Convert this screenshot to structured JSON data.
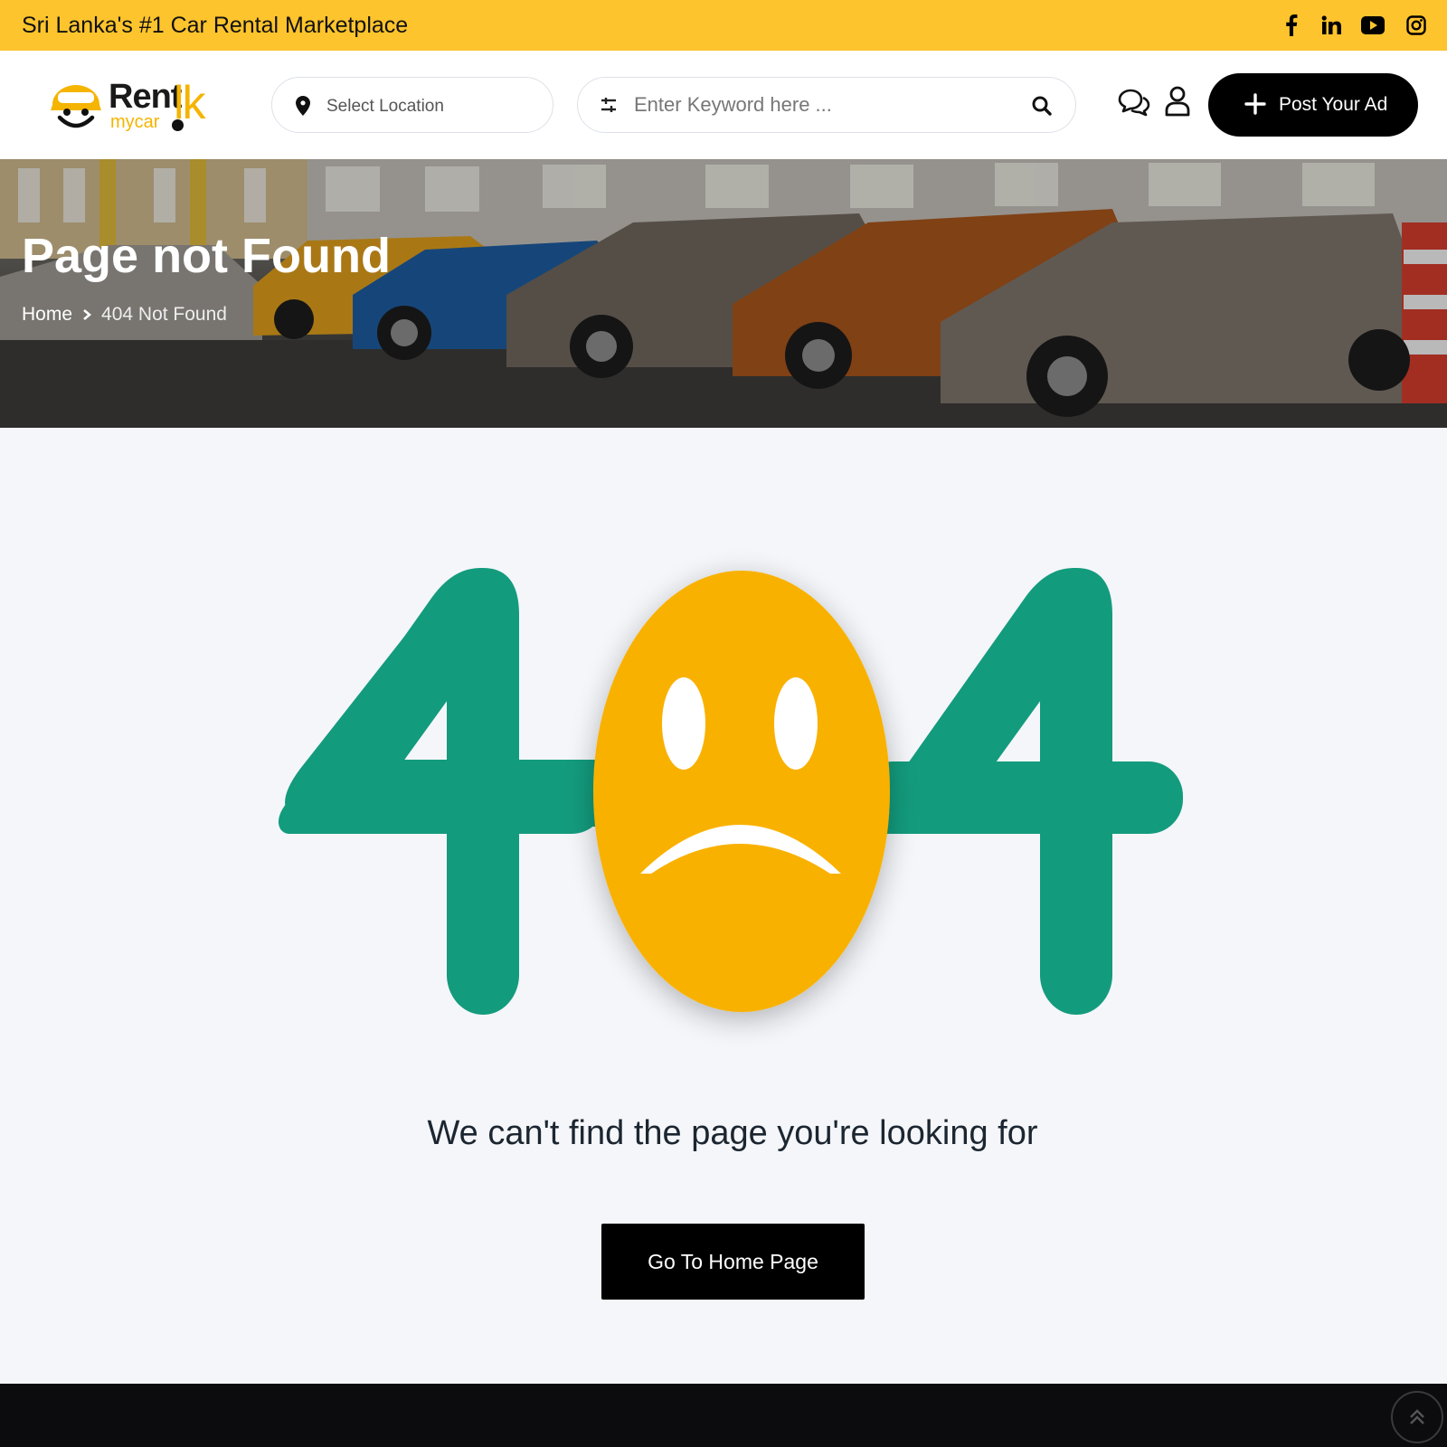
{
  "topbar": {
    "tagline": "Sri Lanka's #1 Car Rental Marketplace",
    "social": [
      "facebook-icon",
      "linkedin-icon",
      "youtube-icon",
      "instagram-icon"
    ]
  },
  "header": {
    "logo": {
      "word1": "Rent",
      "word2": "mycar",
      "word3": "lk"
    },
    "location_placeholder": "Select Location",
    "search_placeholder": "Enter Keyword here ...",
    "post_ad_label": "Post Your Ad"
  },
  "hero": {
    "title": "Page not Found",
    "breadcrumb": {
      "home": "Home",
      "current": "404 Not Found"
    }
  },
  "error": {
    "digit_left": "4",
    "digit_right": "4",
    "message": "We can't find the page you're looking for",
    "home_button": "Go To Home Page"
  },
  "colors": {
    "topbar": "#fec42d",
    "digit_green": "#139b7d",
    "face_yellow": "#f9b103",
    "button_black": "#000000",
    "footer": "#0c0c0e"
  }
}
